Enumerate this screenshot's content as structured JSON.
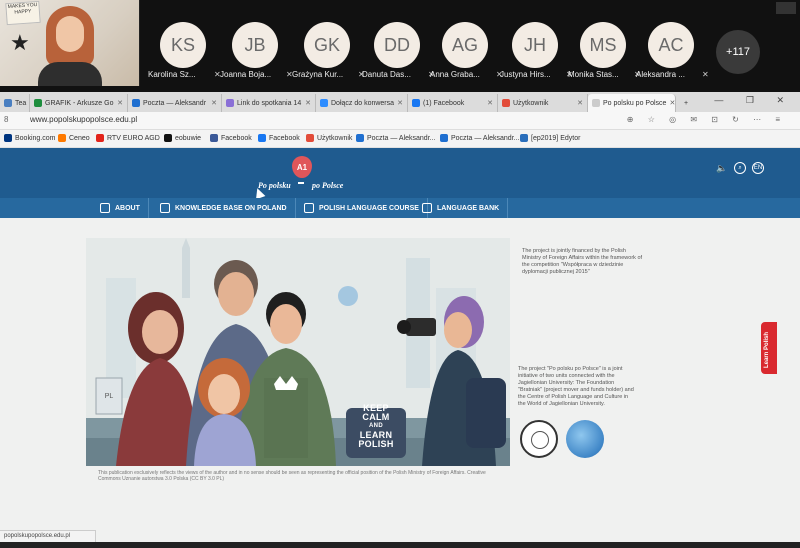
{
  "call": {
    "participants": [
      {
        "initials": "KS",
        "name": "Karolina Sz..."
      },
      {
        "initials": "JB",
        "name": "Joanna Boja..."
      },
      {
        "initials": "GK",
        "name": "Grażyna Kur..."
      },
      {
        "initials": "DD",
        "name": "Danuta Das..."
      },
      {
        "initials": "AG",
        "name": "Anna Graba..."
      },
      {
        "initials": "JH",
        "name": "Justyna Hirs..."
      },
      {
        "initials": "MS",
        "name": "Monika Stas..."
      },
      {
        "initials": "AC",
        "name": "Aleksandra ..."
      }
    ],
    "more_count": "+117",
    "poster_text": "MAKES YOU HAPPY",
    "mic_icon": "muted-mic-icon"
  },
  "browser": {
    "tabs": [
      {
        "label": "Tea",
        "color": "#4a7fc1"
      },
      {
        "label": "GRAFIK - Arkusze Go",
        "color": "#1e8e3e"
      },
      {
        "label": "Poczta — Aleksandr",
        "color": "#1f6fd0"
      },
      {
        "label": "Link do spotkania 14",
        "color": "#8a6fd6"
      },
      {
        "label": "Dołącz do konwersa",
        "color": "#2d8cff"
      },
      {
        "label": "(1) Facebook",
        "color": "#1877f2"
      },
      {
        "label": "Użytkownik",
        "color": "#e24c3a"
      },
      {
        "label": "Po polsku po Polsce",
        "color": "#cccccc"
      }
    ],
    "new_tab_symbol": "+",
    "window_controls": "— ❐ ✕",
    "url": "www.popolskupopolsce.edu.pl",
    "bookmarks": [
      {
        "label": "Booking.com",
        "color": "#003580"
      },
      {
        "label": "Ceneo",
        "color": "#ff7a00"
      },
      {
        "label": "RTV EURO AGD",
        "color": "#e2231a"
      },
      {
        "label": "eobuwie",
        "color": "#111111"
      },
      {
        "label": "Facebook",
        "color": "#3b5998"
      },
      {
        "label": "Facebook",
        "color": "#1877f2"
      },
      {
        "label": "Użytkownik",
        "color": "#e24c3a"
      },
      {
        "label": "Poczta — Aleksandr...",
        "color": "#1f6fd0"
      },
      {
        "label": "Poczta — Aleksandr...",
        "color": "#1f6fd0"
      },
      {
        "label": "[ep2019] Edytor",
        "color": "#2a6ebb"
      }
    ],
    "status_url": "popolskupopolsce.edu.pl"
  },
  "site": {
    "logo_badge": "A1",
    "logo_text_1": "Po polsku",
    "logo_text_2": "po Polsce",
    "header_icon_lang": "EN",
    "nav": [
      {
        "label": "ABOUT",
        "icon": "info-icon"
      },
      {
        "label": "KNOWLEDGE BASE ON POLAND",
        "icon": "link-icon"
      },
      {
        "label": "POLISH LANGUAGE COURSE",
        "icon": "course-icon"
      },
      {
        "label": "LANGUAGE BANK",
        "icon": "bank-icon"
      }
    ],
    "hero_keep": "KEEP",
    "hero_calm": "CALM",
    "hero_and": "AND",
    "hero_learn": "LEARN",
    "hero_polish": "POLISH",
    "hero_pl_sign": "PL",
    "side_text_1": "The project is jointly financed by the Polish Ministry of Foreign Affairs within the framework of the competition \"Współpraca w dziedzinie dyplomacji publicznej 2015\"",
    "side_text_2": "The project \"Po polsku po Polsce\" is a joint initiative of two units connected with the Jagiellonian University: The Foundation \"Bratniak\" (project mover and funds holder) and the Centre of Polish Language and Culture in the World of Jagiellonian University.",
    "footnote": "This publication exclusively reflects the views of the author and in no sense should be seen as representing the official position of the Polish Ministry of Foreign Affairs. Creative Commons Uznanie autorstwa 3.0 Polska (CC BY 3.0 PL)",
    "learn_tab": "Learn Polish",
    "colors": {
      "header": "#1f5b8f",
      "nav": "#27699f",
      "accent_red": "#d9292f",
      "badge": "#e0565a"
    }
  }
}
